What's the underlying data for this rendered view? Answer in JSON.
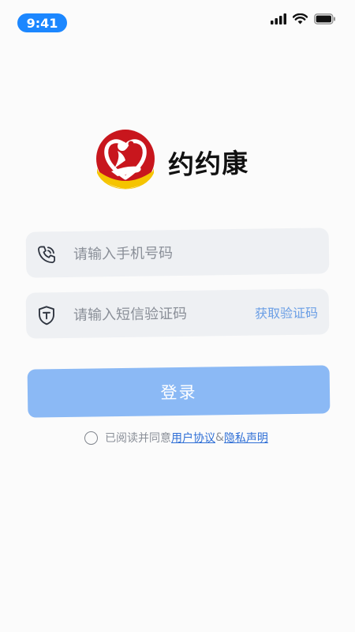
{
  "status_bar": {
    "time": "9:41",
    "icons": [
      "signal-icon",
      "wifi-icon",
      "battery-icon"
    ]
  },
  "brand": {
    "app_name": "约约康",
    "logo": "heart-hand-logo",
    "colors": {
      "red": "#c8161d",
      "yellow": "#f5c400"
    }
  },
  "form": {
    "phone": {
      "placeholder": "请输入手机号码",
      "value": "",
      "icon": "phone-icon"
    },
    "code": {
      "placeholder": "请输入短信验证码",
      "value": "",
      "icon": "shield-icon",
      "get_code_label": "获取验证码"
    },
    "login_label": "登录"
  },
  "agreement": {
    "prefix": "已阅读并同意",
    "user_agreement": "用户协议",
    "connector": "&",
    "privacy": "隐私声明",
    "checked": false
  },
  "colors": {
    "accent": "#1c87ff",
    "button": "#8bb9f5",
    "link": "#2f6fd6",
    "field_bg": "#eef0f3"
  }
}
